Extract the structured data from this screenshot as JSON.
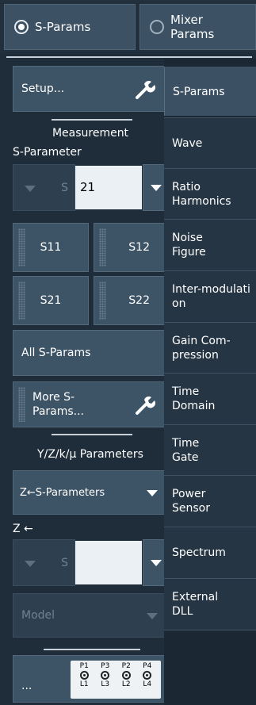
{
  "mode": {
    "sparams_label": "S-Params",
    "mixer_label": "Mixer Params"
  },
  "left": {
    "setup_label": "Setup...",
    "measurement_label": "Measurement",
    "sparameter_label": "S-Parameter",
    "s_prefix": "S",
    "s_value": "21",
    "s_buttons": [
      "S11",
      "S12",
      "S21",
      "S22"
    ],
    "all_sparams_label": "All S-Params",
    "more_sparams_label": "More S-Params...",
    "yzk_label": "Y/Z/k/μ Parameters",
    "conv_select_label": "Z←S-Parameters",
    "z_label": "Z ←",
    "z_s_prefix": "S",
    "z_value": "",
    "model_label": "Model",
    "ellipsis_label": "...",
    "port_top": [
      "P1",
      "P3",
      "P2",
      "P4"
    ],
    "port_bottom": [
      "L1",
      "L3",
      "L2",
      "L4"
    ]
  },
  "tabs": [
    {
      "label": "S-Params"
    },
    {
      "label": "Wave"
    },
    {
      "label": "Ratio Harmonics"
    },
    {
      "label": "Noise Figure"
    },
    {
      "label": "Inter-modulation"
    },
    {
      "label": "Gain Com-pression"
    },
    {
      "label": "Time Domain"
    },
    {
      "label": "Time Gate"
    },
    {
      "label": "Power Sensor"
    },
    {
      "label": "Spectrum"
    },
    {
      "label": "External DLL"
    }
  ],
  "colors": {
    "background": "#1f2d3a",
    "button": "#3d5366",
    "active_tab": "#3b5062"
  },
  "icons": [
    "radio-selected-icon",
    "radio-unselected-icon",
    "wrench-icon",
    "dropdown-arrow-icon",
    "port-connector-icon"
  ]
}
